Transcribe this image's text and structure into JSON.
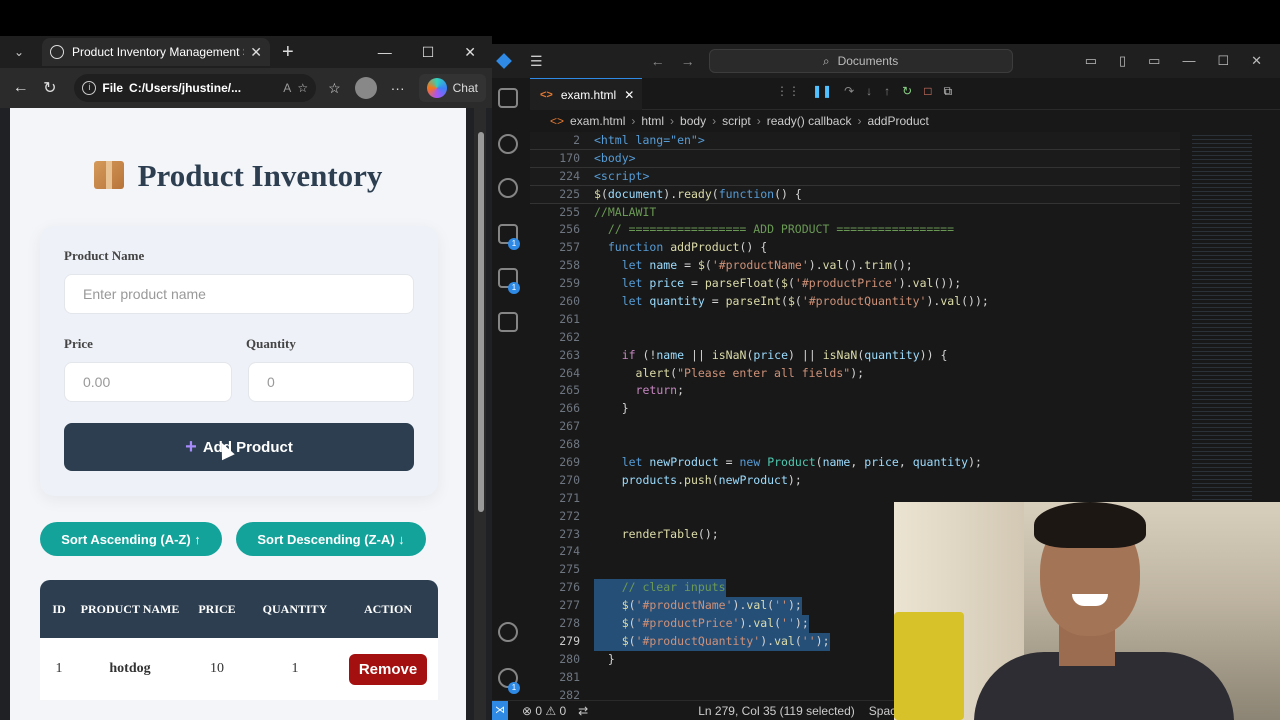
{
  "browser": {
    "tab_title": "Product Inventory Management Sy",
    "address_prefix": "File",
    "address_path": "C:/Users/jhustine/...",
    "chat_label": "Chat"
  },
  "app": {
    "title": "Product Inventory",
    "product_name_label": "Product Name",
    "product_name_placeholder": "Enter product name",
    "price_label": "Price",
    "price_placeholder": "0.00",
    "quantity_label": "Quantity",
    "quantity_placeholder": "0",
    "add_button": "Add Product",
    "sort_asc": "Sort Ascending (A-Z) ↑",
    "sort_desc": "Sort Descending (Z-A) ↓",
    "table": {
      "headers": [
        "ID",
        "PRODUCT NAME",
        "PRICE",
        "QUANTITY",
        "ACTION"
      ],
      "rows": [
        {
          "id": "1",
          "name": "hotdog",
          "price": "10",
          "quantity": "1",
          "action": "Remove"
        }
      ]
    }
  },
  "vscode": {
    "search": "Documents",
    "tab": "exam.html",
    "breadcrumbs": [
      "exam.html",
      "html",
      "body",
      "script",
      "ready() callback",
      "addProduct"
    ],
    "status": {
      "problems": "⊗ 0 ⚠ 0",
      "position": "Ln 279, Col 35 (119 selected)",
      "spaces": "Spaces"
    },
    "code_lines": [
      {
        "n": "2",
        "t": "<html lang=\"en\">"
      },
      {
        "n": "170",
        "t": "<body>"
      },
      {
        "n": "224",
        "t": "<script>"
      },
      {
        "n": "225",
        "t": "$(document).ready(function() {"
      },
      {
        "n": "255",
        "t": "//MALAWIT"
      },
      {
        "n": "256",
        "t": "  // ================= ADD PRODUCT ================="
      },
      {
        "n": "257",
        "t": "  function addProduct() {"
      },
      {
        "n": "258",
        "t": "    let name = $('#productName').val().trim();"
      },
      {
        "n": "259",
        "t": "    let price = parseFloat($('#productPrice').val());"
      },
      {
        "n": "260",
        "t": "    let quantity = parseInt($('#productQuantity').val());"
      },
      {
        "n": "261",
        "t": ""
      },
      {
        "n": "262",
        "t": ""
      },
      {
        "n": "263",
        "t": "    if (!name || isNaN(price) || isNaN(quantity)) {"
      },
      {
        "n": "264",
        "t": "      alert(\"Please enter all fields\");"
      },
      {
        "n": "265",
        "t": "      return;"
      },
      {
        "n": "266",
        "t": "    }"
      },
      {
        "n": "267",
        "t": ""
      },
      {
        "n": "268",
        "t": ""
      },
      {
        "n": "269",
        "t": "    let newProduct = new Product(name, price, quantity);"
      },
      {
        "n": "270",
        "t": "    products.push(newProduct);"
      },
      {
        "n": "271",
        "t": ""
      },
      {
        "n": "272",
        "t": ""
      },
      {
        "n": "273",
        "t": "    renderTable();"
      },
      {
        "n": "274",
        "t": ""
      },
      {
        "n": "275",
        "t": ""
      },
      {
        "n": "276",
        "t": "    // clear inputs"
      },
      {
        "n": "277",
        "t": "    $('#productName').val('');"
      },
      {
        "n": "278",
        "t": "    $('#productPrice').val('');"
      },
      {
        "n": "279",
        "t": "    $('#productQuantity').val('');"
      },
      {
        "n": "280",
        "t": "  }"
      },
      {
        "n": "281",
        "t": ""
      },
      {
        "n": "282",
        "t": ""
      }
    ]
  }
}
